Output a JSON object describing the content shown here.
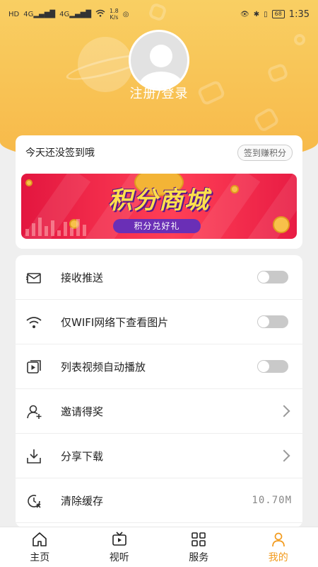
{
  "status_bar": {
    "network_left": "HD",
    "signal_1": "4G",
    "signal_2": "4G",
    "speed_value": "1.8",
    "speed_unit": "K/s",
    "battery": "68",
    "time": "1:35"
  },
  "profile": {
    "login_text": "注册/登录"
  },
  "signin": {
    "prompt": "今天还没签到哦",
    "button": "签到赚积分"
  },
  "banner": {
    "title": "积分商城",
    "subtitle": "积分兑好礼"
  },
  "settings": [
    {
      "label": "接收推送",
      "icon": "envelope-icon",
      "control": "toggle",
      "on": false
    },
    {
      "label": "仅WIFI网络下查看图片",
      "icon": "wifi-icon",
      "control": "toggle",
      "on": false
    },
    {
      "label": "列表视频自动播放",
      "icon": "video-play-icon",
      "control": "toggle",
      "on": false
    },
    {
      "label": "邀请得奖",
      "icon": "add-user-icon",
      "control": "chevron"
    },
    {
      "label": "分享下载",
      "icon": "download-icon",
      "control": "chevron"
    },
    {
      "label": "清除缓存",
      "icon": "clear-cache-icon",
      "control": "value",
      "value": "10.70M"
    }
  ],
  "bottom_nav": [
    {
      "label": "主页",
      "icon": "home-icon",
      "active": false
    },
    {
      "label": "视听",
      "icon": "tv-icon",
      "active": false
    },
    {
      "label": "服务",
      "icon": "grid-icon",
      "active": false
    },
    {
      "label": "我的",
      "icon": "person-icon",
      "active": true
    }
  ],
  "colors": {
    "header_top": "#f9cf63",
    "header_bottom": "#f7b848",
    "accent": "#f29a1c",
    "banner_red": "#e3163f",
    "banner_purple": "#6a2fb6"
  }
}
